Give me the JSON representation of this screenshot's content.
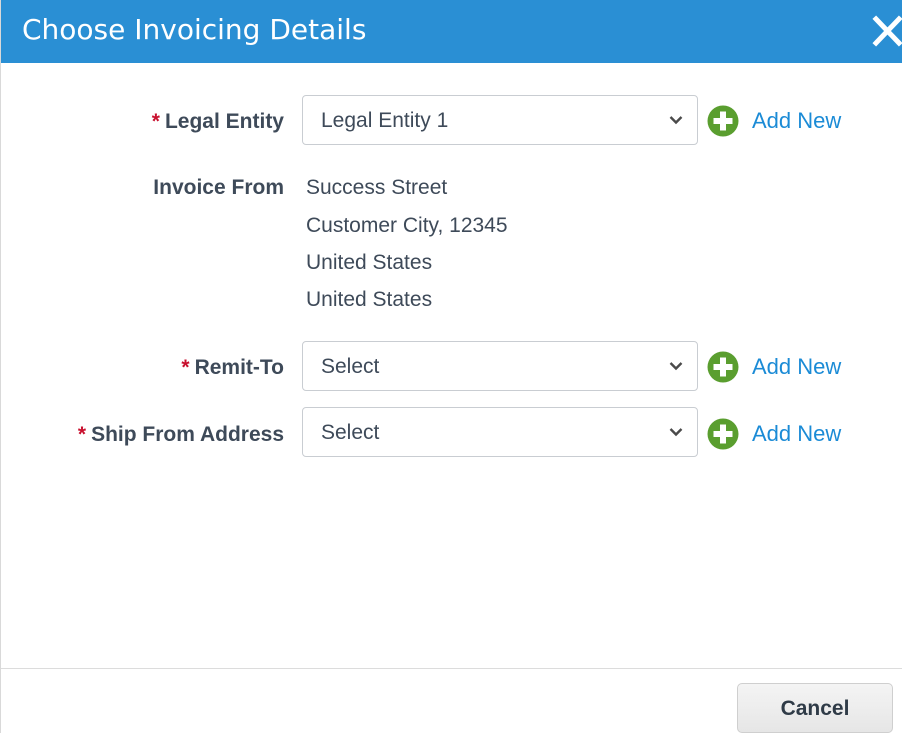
{
  "dialog": {
    "title": "Choose Invoicing Details",
    "close_icon": "close-icon"
  },
  "form": {
    "legal_entity": {
      "label": "Legal Entity",
      "required_marker": "*",
      "value": "Legal Entity 1",
      "add_new_label": "Add New"
    },
    "invoice_from": {
      "label": "Invoice From",
      "address_lines": [
        "Success Street",
        "Customer City, 12345",
        "United States",
        "United States"
      ]
    },
    "remit_to": {
      "label": "Remit-To",
      "required_marker": "*",
      "value": "Select",
      "add_new_label": "Add New"
    },
    "ship_from_address": {
      "label": "Ship From Address",
      "required_marker": "*",
      "value": "Select",
      "add_new_label": "Add New"
    }
  },
  "footer": {
    "cancel_label": "Cancel"
  },
  "colors": {
    "header_bg": "#2a8fd4",
    "link": "#1b8bd6",
    "add_icon": "#5a9e2f",
    "required": "#c8102e",
    "label_text": "#3e4a59"
  }
}
